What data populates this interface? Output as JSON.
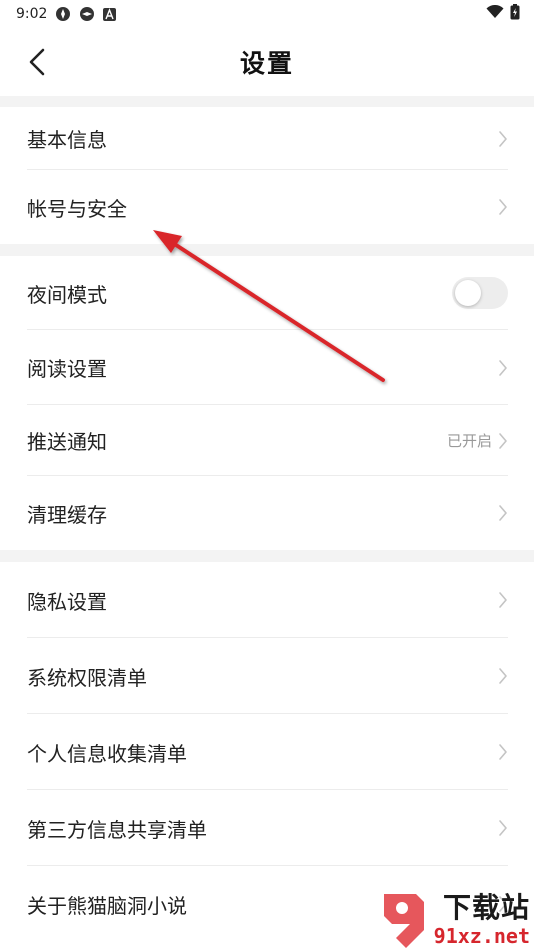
{
  "status_bar": {
    "time": "9:02"
  },
  "header": {
    "title": "设置"
  },
  "sections": [
    {
      "items": [
        {
          "label": "基本信息",
          "type": "chevron"
        },
        {
          "label": "帐号与安全",
          "type": "chevron"
        }
      ]
    },
    {
      "items": [
        {
          "label": "夜间模式",
          "type": "toggle",
          "on": false
        },
        {
          "label": "阅读设置",
          "type": "chevron"
        },
        {
          "label": "推送通知",
          "type": "chevron",
          "value": "已开启"
        },
        {
          "label": "清理缓存",
          "type": "chevron"
        }
      ]
    },
    {
      "items": [
        {
          "label": "隐私设置",
          "type": "chevron"
        },
        {
          "label": "系统权限清单",
          "type": "chevron"
        },
        {
          "label": "个人信息收集清单",
          "type": "chevron"
        },
        {
          "label": "第三方信息共享清单",
          "type": "chevron"
        },
        {
          "label": "关于熊猫脑洞小说",
          "type": "chevron"
        }
      ]
    }
  ],
  "watermark": {
    "top": "下载站",
    "bottom": "91xz.net"
  },
  "colors": {
    "annotation_arrow": "#d9262c",
    "section_gap": "#f3f3f3",
    "chevron": "#c4c4c4",
    "toggle_off": "#ededed"
  }
}
